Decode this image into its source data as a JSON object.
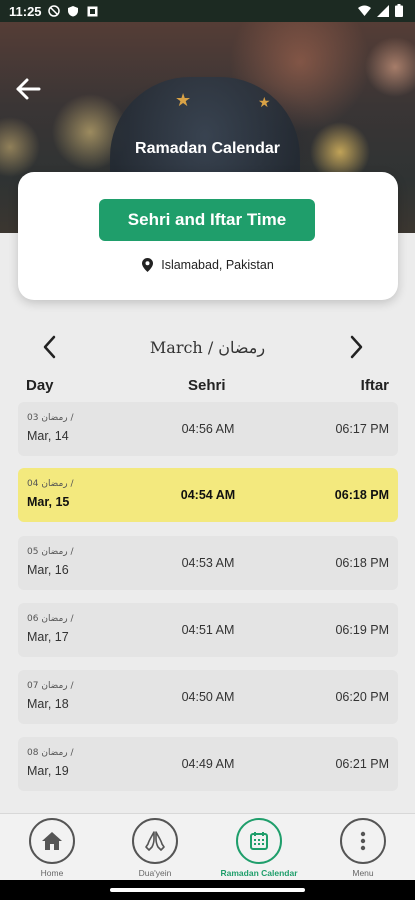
{
  "status_bar": {
    "time": "11:25"
  },
  "header": {
    "title": "Ramadan Calendar"
  },
  "card": {
    "button_label": "Sehri and Iftar Time",
    "location": "Islamabad, Pakistan"
  },
  "month_nav": {
    "month": "March",
    "separator": " / ",
    "hijri_month": "رمضان"
  },
  "columns": {
    "day": "Day",
    "sehri": "Sehri",
    "iftar": "Iftar"
  },
  "rows": [
    {
      "hijri": "03 رمضان /",
      "date": "Mar, 14",
      "sehri": "04:56 AM",
      "iftar": "06:17 PM",
      "highlight": false
    },
    {
      "hijri": "04 رمضان /",
      "date": "Mar, 15",
      "sehri": "04:54 AM",
      "iftar": "06:18 PM",
      "highlight": true
    },
    {
      "hijri": "05 رمضان /",
      "date": "Mar, 16",
      "sehri": "04:53 AM",
      "iftar": "06:18 PM",
      "highlight": false
    },
    {
      "hijri": "06 رمضان /",
      "date": "Mar, 17",
      "sehri": "04:51 AM",
      "iftar": "06:19 PM",
      "highlight": false
    },
    {
      "hijri": "07 رمضان /",
      "date": "Mar, 18",
      "sehri": "04:50 AM",
      "iftar": "06:20 PM",
      "highlight": false
    },
    {
      "hijri": "08 رمضان /",
      "date": "Mar, 19",
      "sehri": "04:49 AM",
      "iftar": "06:21 PM",
      "highlight": false
    }
  ],
  "bottom_nav": [
    {
      "label": "Home",
      "icon": "home-icon",
      "active": false
    },
    {
      "label": "Dua'yein",
      "icon": "praying-hands-icon",
      "active": false
    },
    {
      "label": "Ramadan Calendar",
      "icon": "calendar-icon",
      "active": true
    },
    {
      "label": "Menu",
      "icon": "more-vertical-icon",
      "active": false
    }
  ],
  "colors": {
    "accent": "#1f9e6b",
    "highlight": "#f3e97e",
    "row": "#e4e4e4"
  }
}
